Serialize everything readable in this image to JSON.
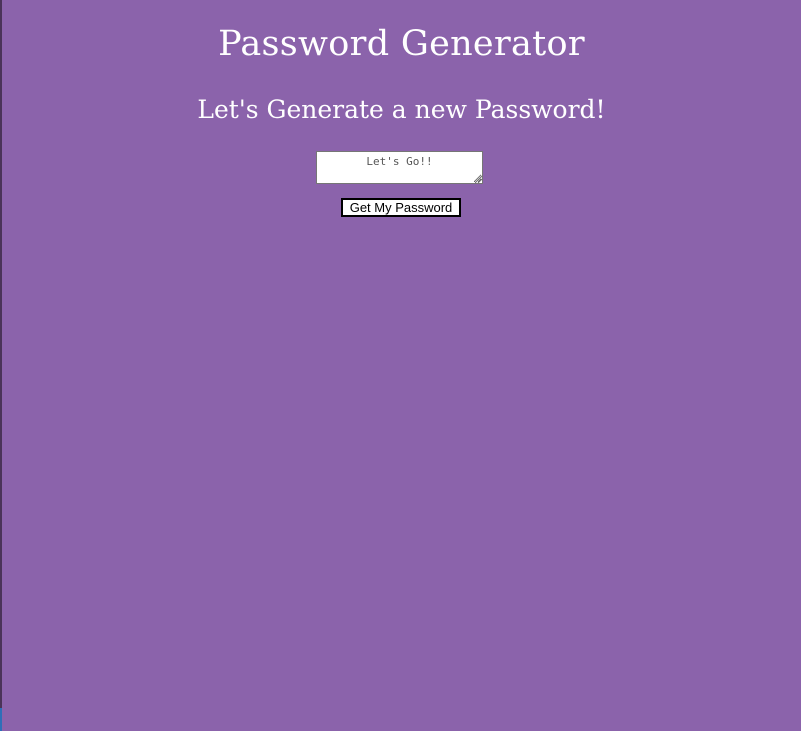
{
  "header": {
    "title": "Password Generator",
    "subtitle": "Let's Generate a new Password!"
  },
  "form": {
    "password_placeholder": "Let's Go!!",
    "password_value": "",
    "generate_button_label": "Get My Password"
  },
  "colors": {
    "background": "#8b63ab",
    "text": "#ffffff",
    "left_edge": "#4a3358",
    "left_edge_accent": "#2e6fb8"
  }
}
